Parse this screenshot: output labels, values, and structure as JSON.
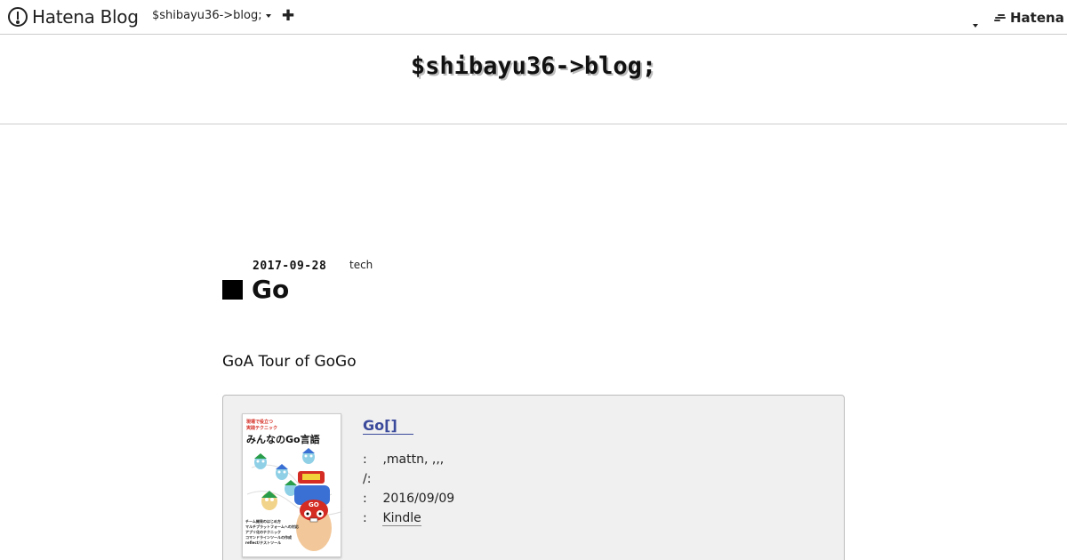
{
  "topbar": {
    "brand": "Hatena Blog",
    "blog_switch": "$shibayu36->blog;",
    "add_button": "✚",
    "hatena_logo": "Hatena"
  },
  "blog": {
    "title": "$shibayu36->blog;"
  },
  "entry": {
    "date": "2017-09-28",
    "category": "tech",
    "title": "Go",
    "intro": "GoA Tour of GoGo"
  },
  "product": {
    "title": "Go[]",
    "cover_text": {
      "tagline1": "現場で役立つ",
      "tagline2": "実践テクニック",
      "main": "みんなのGo言語",
      "bullets": [
        "チーム開発のはじめ方",
        "マルチプラットフォームへの対応",
        "アプリ化のテクニック",
        "コマンドラインツールの作成",
        "reflect/テストツール"
      ]
    },
    "meta": [
      {
        "label": ":",
        "value": ",mattn,  ,,,"
      },
      {
        "label": "/:",
        "value": ""
      },
      {
        "label": ":",
        "value": "2016/09/09"
      },
      {
        "label": ":",
        "value": "Kindle"
      }
    ]
  },
  "colors": {
    "link": "#3b4a9b",
    "box_bg": "#f0f0f0",
    "gopher_cyan": "#4fb8d8",
    "gopher_red": "#d42b22"
  }
}
